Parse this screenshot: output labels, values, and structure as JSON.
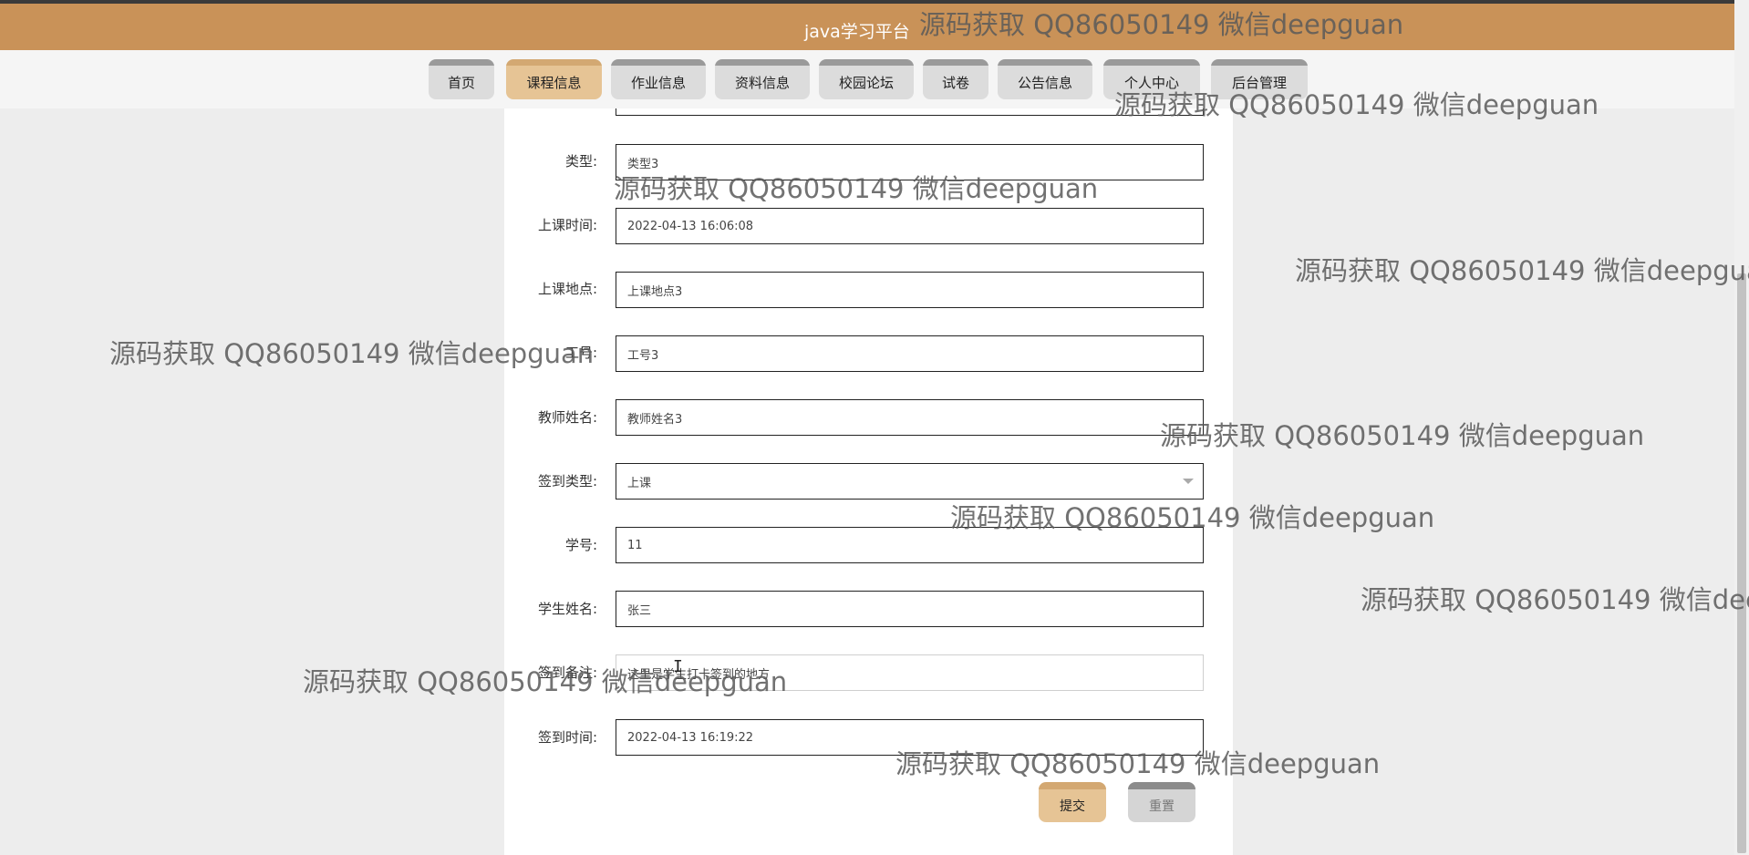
{
  "header": {
    "title": "java学习平台"
  },
  "nav": {
    "tabs": [
      {
        "label": "首页"
      },
      {
        "label": "课程信息"
      },
      {
        "label": "作业信息"
      },
      {
        "label": "资料信息"
      },
      {
        "label": "校园论坛"
      },
      {
        "label": "试卷"
      },
      {
        "label": "公告信息"
      },
      {
        "label": "个人中心"
      },
      {
        "label": "后台管理"
      }
    ],
    "active_index": 1
  },
  "form": {
    "fields": [
      {
        "label": "类型:",
        "value": "类型3"
      },
      {
        "label": "上课时间:",
        "value": "2022-04-13 16:06:08"
      },
      {
        "label": "上课地点:",
        "value": "上课地点3"
      },
      {
        "label": "工号:",
        "value": "工号3"
      },
      {
        "label": "教师姓名:",
        "value": "教师姓名3"
      },
      {
        "label": "签到类型:",
        "value": "上课"
      },
      {
        "label": "学号:",
        "value": "11"
      },
      {
        "label": "学生姓名:",
        "value": "张三"
      },
      {
        "label": "签到备注:",
        "value": "这里是学生打卡签到的地方"
      },
      {
        "label": "签到时间:",
        "value": "2022-04-13 16:19:22"
      }
    ],
    "submit_label": "提交",
    "reset_label": "重置"
  },
  "watermark": {
    "text": "源码获取 QQ86050149 微信deepguan"
  },
  "colors": {
    "header": "#c99258",
    "active_tab": "#e6c495",
    "tab": "#dcdcdc"
  }
}
